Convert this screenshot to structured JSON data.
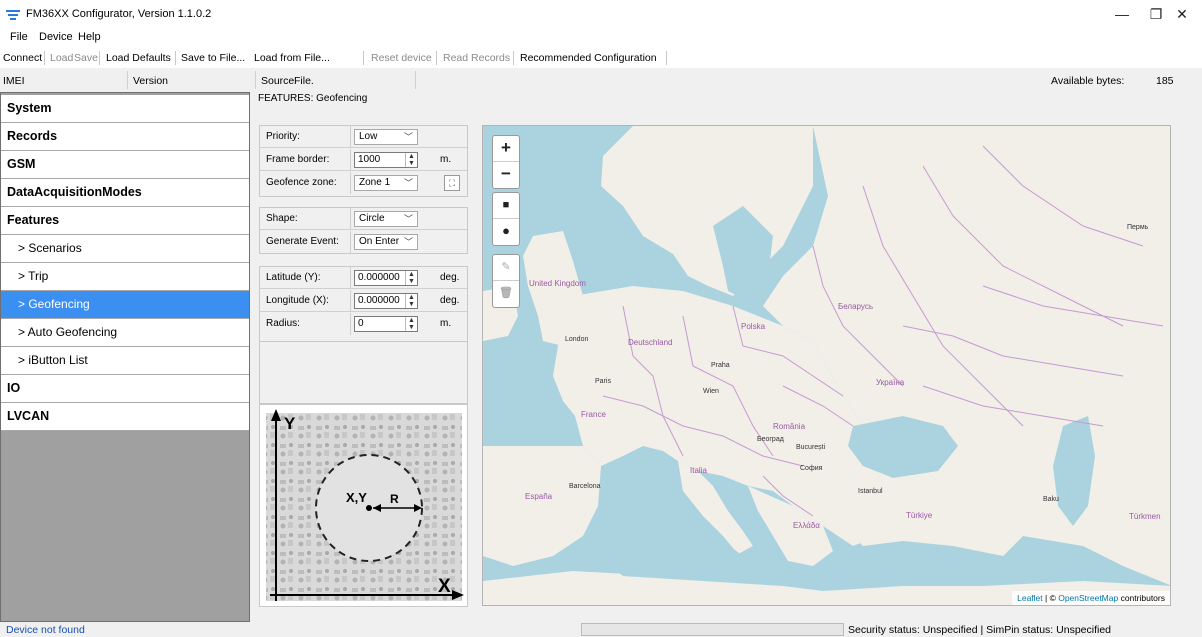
{
  "window": {
    "title": "FM36XX Configurator, Version 1.1.0.2",
    "minimize": "—",
    "maximize": "❐",
    "close": "✕"
  },
  "menu": [
    "File",
    "Device",
    "Help"
  ],
  "toolbar": {
    "connect": "Connect",
    "load": "Load",
    "save": "Save",
    "load_defaults": "Load Defaults",
    "save_to_file": "Save to File...",
    "load_from_file": "Load from File...",
    "reset_device": "Reset device",
    "read_records": "Read Records",
    "recommended": "Recommended Configuration"
  },
  "info": {
    "imei": "IMEI",
    "version": "Version",
    "source": "Source",
    "source_value": "File.",
    "available_bytes_label": "Available bytes:",
    "available_bytes": "185"
  },
  "nav": [
    {
      "label": "System",
      "level": "top"
    },
    {
      "label": "Records",
      "level": "top"
    },
    {
      "label": "GSM",
      "level": "top"
    },
    {
      "label": "DataAcquisitionModes",
      "level": "top"
    },
    {
      "label": "Features",
      "level": "top"
    },
    {
      "label": "> Scenarios",
      "level": "sub"
    },
    {
      "label": "> Trip",
      "level": "sub"
    },
    {
      "label": "> Geofencing",
      "level": "sub",
      "selected": true
    },
    {
      "label": "> Auto Geofencing",
      "level": "sub"
    },
    {
      "label": "> iButton List",
      "level": "sub"
    },
    {
      "label": "IO",
      "level": "top"
    },
    {
      "label": "LVCAN",
      "level": "top"
    }
  ],
  "features_title": "FEATURES: Geofencing",
  "form": {
    "priority": {
      "label": "Priority:",
      "value": "Low"
    },
    "frame_border": {
      "label": "Frame border:",
      "value": "1000",
      "unit": "m."
    },
    "zone": {
      "label": "Geofence zone:",
      "value": "Zone 1"
    },
    "shape": {
      "label": "Shape:",
      "value": "Circle"
    },
    "event": {
      "label": "Generate Event:",
      "value": "On Enter"
    },
    "latitude": {
      "label": "Latitude (Y):",
      "value": "0.000000",
      "unit": "deg."
    },
    "longitude": {
      "label": "Longitude (X):",
      "value": "0.000000",
      "unit": "deg."
    },
    "radius": {
      "label": "Radius:",
      "value": "0",
      "unit": "m."
    }
  },
  "diagram": {
    "y_label": "Y",
    "x_label": "X",
    "center_label": "X,Y",
    "radius_label": "R"
  },
  "map": {
    "zoom_in": "+",
    "zoom_out": "−",
    "attribution_leaflet": "Leaflet",
    "attribution_sep": " | © ",
    "attribution_osm": "OpenStreetMap",
    "attribution_tail": " contributors",
    "labels": [
      "United Kingdom",
      "Deutschland",
      "France",
      "Polska",
      "Беларусь",
      "Україна",
      "România",
      "Italia",
      "España",
      "Türkiye",
      "Ελλάδα",
      "London",
      "Paris",
      "Praha",
      "Wien",
      "Београд",
      "București",
      "София",
      "Barcelona",
      "Istanbul",
      "Baku",
      "Пермь",
      "Türkmen"
    ]
  },
  "status": {
    "left": "Device not found",
    "right": "Security status:  Unspecified  |  SimPin status:  Unspecified"
  }
}
